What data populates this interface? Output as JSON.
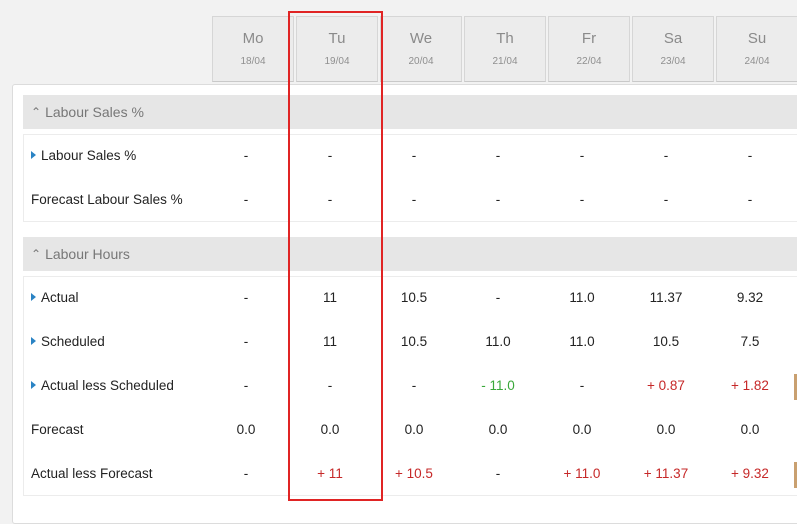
{
  "days": [
    {
      "name": "Mo",
      "date": "18/04"
    },
    {
      "name": "Tu",
      "date": "19/04"
    },
    {
      "name": "We",
      "date": "20/04"
    },
    {
      "name": "Th",
      "date": "21/04"
    },
    {
      "name": "Fr",
      "date": "22/04"
    },
    {
      "name": "Sa",
      "date": "23/04"
    },
    {
      "name": "Su",
      "date": "24/04"
    }
  ],
  "sections": {
    "labour_sales": {
      "title": "Labour Sales %",
      "rows": [
        {
          "label": "Labour Sales %",
          "expandable": true,
          "values": [
            "-",
            "-",
            "-",
            "-",
            "-",
            "-",
            "-"
          ]
        },
        {
          "label": "Forecast Labour Sales %",
          "expandable": false,
          "values": [
            "-",
            "-",
            "-",
            "-",
            "-",
            "-",
            "-"
          ]
        }
      ]
    },
    "labour_hours": {
      "title": "Labour Hours",
      "rows": [
        {
          "label": "Actual",
          "expandable": true,
          "values": [
            "-",
            "11",
            "10.5",
            "-",
            "11.0",
            "11.37",
            "9.32"
          ]
        },
        {
          "label": "Scheduled",
          "expandable": true,
          "values": [
            "-",
            "11",
            "10.5",
            "11.0",
            "11.0",
            "10.5",
            "7.5"
          ]
        },
        {
          "label": "Actual less Scheduled",
          "expandable": true,
          "values": [
            "-",
            "-",
            "-",
            "- 11.0",
            "-",
            "+ 0.87",
            "+ 1.82"
          ]
        },
        {
          "label": "Forecast",
          "expandable": false,
          "values": [
            "0.0",
            "0.0",
            "0.0",
            "0.0",
            "0.0",
            "0.0",
            "0.0"
          ]
        },
        {
          "label": "Actual less Forecast",
          "expandable": false,
          "values": [
            "-",
            "+ 11",
            "+ 10.5",
            "-",
            "+ 11.0",
            "+ 11.37",
            "+ 9.32"
          ]
        }
      ]
    }
  },
  "colors": {
    "positive": "#c62828",
    "negative": "#3aa83a",
    "highlight": "#e02424",
    "expand_arrow": "#2a83c4"
  }
}
